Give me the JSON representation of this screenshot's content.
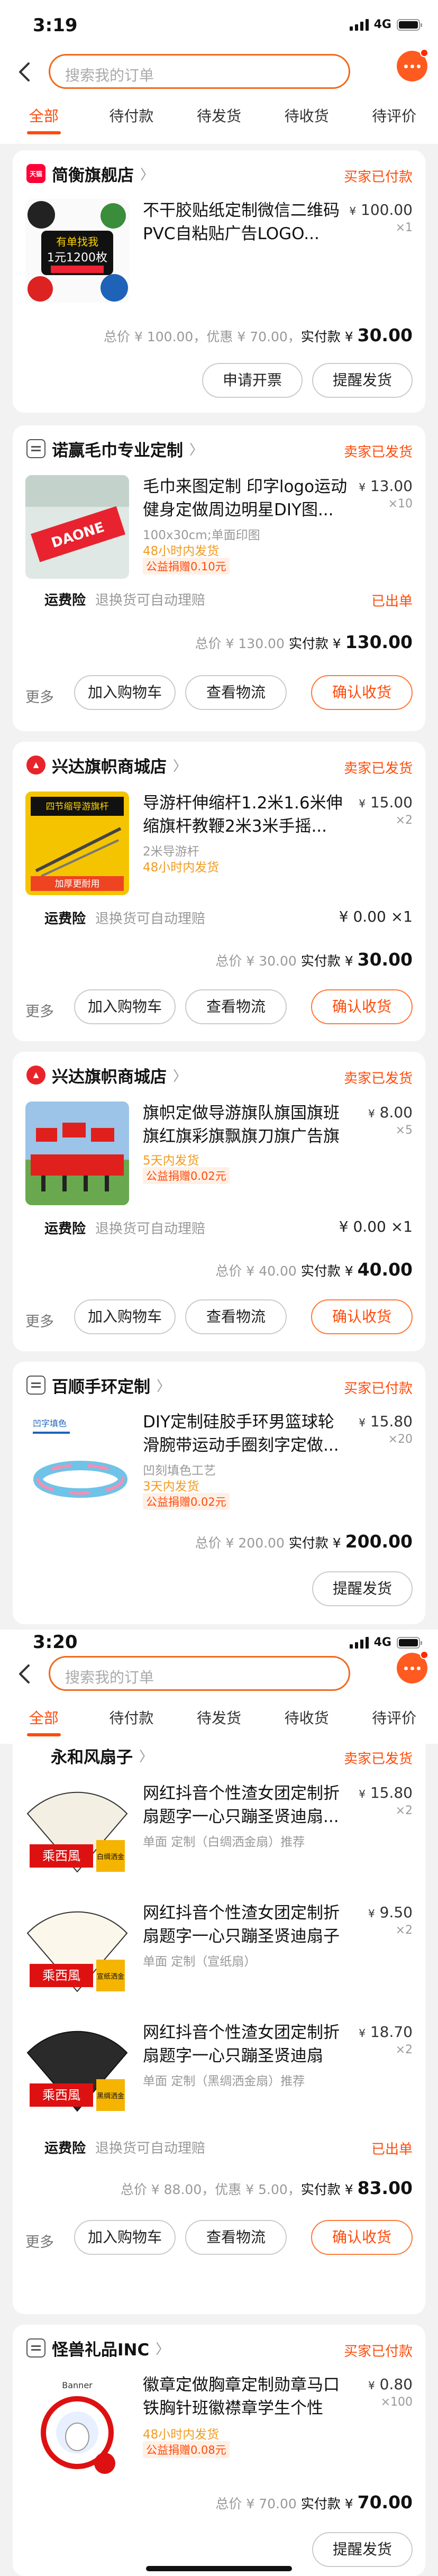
{
  "screens": [
    {
      "time": "3:19",
      "network": "4G"
    },
    {
      "time": "3:20",
      "network": "4G"
    }
  ],
  "search": {
    "placeholder": "搜索我的订单"
  },
  "tabs": [
    "全部",
    "待付款",
    "待发货",
    "待收货",
    "待评价"
  ],
  "orders": [
    {
      "shop": "简衡旗舰店",
      "status": "买家已付款",
      "items": [
        {
          "title": "不干胶贴纸定制微信二维码PVC自粘贴广告LOGO...",
          "price": "100.00",
          "qty": "×1",
          "thumb_text": "有单找我 1元1200枚 专业定制 快速发货"
        }
      ],
      "summary": {
        "total": "100.00",
        "discount": "70.00",
        "paid": "30.00"
      },
      "buttons": [
        "申请开票",
        "提醒发货"
      ]
    },
    {
      "shop": "诺赢毛巾专业定制",
      "status": "卖家已发货",
      "items": [
        {
          "title": "毛巾来图定制 印字logo运动健身定做周边明星DIY图...",
          "price": "13.00",
          "qty": "×10",
          "spec": "100x30cm;单面印图",
          "ship": "48小时内发货",
          "sub": "公益捐赠0.10元",
          "thumb_text": "DAONE"
        }
      ],
      "service": {
        "label": "运费险",
        "desc": "退换货可自动理赔",
        "right": "已出单"
      },
      "summary": {
        "total": "130.00",
        "paid": "130.00"
      },
      "more": "更多",
      "buttons": [
        "加入购物车",
        "查看物流",
        "确认收货"
      ]
    },
    {
      "shop": "兴达旗帜商城店",
      "status": "卖家已发货",
      "items": [
        {
          "title": "导游杆伸缩杆1.2米1.6米伸缩旗杆教鞭2米3米手摇...",
          "price": "15.00",
          "qty": "×2",
          "spec": "2米导游杆",
          "ship": "48小时内发货",
          "thumb_text": "四节缩导游旗杆 收缩长度1米 加厚更耐用"
        }
      ],
      "service": {
        "label": "运费险",
        "desc": "退换货可自动理赔",
        "right": "¥ 0.00 ×1"
      },
      "summary": {
        "total": "30.00",
        "paid": "30.00"
      },
      "more": "更多",
      "buttons": [
        "加入购物车",
        "查看物流",
        "确认收货"
      ]
    },
    {
      "shop": "兴达旗帜商城店",
      "status": "卖家已发货",
      "items": [
        {
          "title": "旗帜定做导游旗队旗国旗班旗红旗彩旗飘旗刀旗广告旗订...",
          "price": "8.00",
          "qty": "×5",
          "ship": "5天内发货",
          "sub": "公益捐赠0.02元"
        }
      ],
      "service": {
        "label": "运费险",
        "desc": "退换货可自动理赔",
        "right": "¥ 0.00 ×1"
      },
      "summary": {
        "total": "40.00",
        "paid": "40.00"
      },
      "more": "更多",
      "buttons": [
        "加入购物车",
        "查看物流",
        "确认收货"
      ]
    },
    {
      "shop": "百顺手环定制",
      "status": "买家已付款",
      "items": [
        {
          "title": "DIY定制硅胶手环男篮球轮滑腕带运动手圈刻字定做...",
          "price": "15.80",
          "qty": "×20",
          "spec": "凹刻填色工艺",
          "ship": "3天内发货",
          "sub": "公益捐赠0.02元",
          "thumb_text": "凹字填色"
        }
      ],
      "summary": {
        "total": "200.00",
        "paid": "200.00"
      },
      "buttons": [
        "提醒发货"
      ]
    },
    {
      "shop": "永和风扇子",
      "status": "卖家已发货",
      "items": [
        {
          "title": "网红抖音个性渣女团定制折扇题字一心只蹦圣贤迪扇...",
          "price": "15.80",
          "qty": "×2",
          "spec": "单面 定制（白绸洒金扇）推荐",
          "thumb_text": "乘西風",
          "tag": "白绸洒金"
        },
        {
          "title": "网红抖音个性渣女团定制折扇题字一心只蹦圣贤迪扇子酒...",
          "price": "9.50",
          "qty": "×2",
          "spec": "单面 定制（宣纸扇）",
          "thumb_text": "乘西風",
          "tag": "宣纸洒金"
        },
        {
          "title": "网红抖音个性渣女团定制折扇题字一心只蹦圣贤迪扇子...",
          "price": "18.70",
          "qty": "×2",
          "spec": "单面 定制（黑绸洒金扇）推荐",
          "thumb_text": "乘西風",
          "tag": "黑绸洒金"
        }
      ],
      "service": {
        "label": "运费险",
        "desc": "退换货可自动理赔",
        "right": "已出单"
      },
      "summary": {
        "total": "88.00",
        "discount": "5.00",
        "paid": "83.00"
      },
      "more": "更多",
      "buttons": [
        "加入购物车",
        "查看物流",
        "确认收货"
      ]
    },
    {
      "shop": "怪兽礼品INC",
      "status": "买家已付款",
      "items": [
        {
          "title": "徽章定做胸章定制勋章马口铁胸针班徽襟章学生个性log...",
          "price": "0.80",
          "qty": "×100",
          "ship": "48小时内发货",
          "sub": "公益捐赠0.08元",
          "thumb_text": "Banner"
        }
      ],
      "summary": {
        "total": "70.00",
        "paid": "70.00"
      },
      "buttons": [
        "提醒发货"
      ]
    }
  ],
  "labels": {
    "total": "总价",
    "discount": "优惠",
    "paid": "实付款",
    "yen": "¥"
  }
}
